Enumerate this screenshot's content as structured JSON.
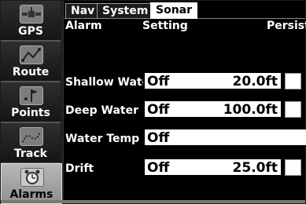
{
  "sidebar": {
    "items": [
      {
        "label": "GPS",
        "icon": "satellite-icon",
        "active": false
      },
      {
        "label": "Route",
        "icon": "route-icon",
        "active": false
      },
      {
        "label": "Points",
        "icon": "points-icon",
        "active": false
      },
      {
        "label": "Track",
        "icon": "track-icon",
        "active": false
      },
      {
        "label": "Alarms",
        "icon": "alarm-clock-icon",
        "active": true
      }
    ]
  },
  "tabs": [
    {
      "label": "Nav",
      "active": false
    },
    {
      "label": "System",
      "active": false
    },
    {
      "label": "Sonar",
      "active": true
    }
  ],
  "columns": {
    "alarm": "Alarm",
    "setting": "Setting",
    "persist": "Persist"
  },
  "rows": [
    {
      "label": "Shallow Water",
      "state": "Off",
      "value": "20.0ft"
    },
    {
      "label": "Deep Water",
      "state": "Off",
      "value": "100.0ft"
    },
    {
      "label": "Water Temp",
      "state": "Off",
      "value": ""
    },
    {
      "label": "Drift",
      "state": "Off",
      "value": "25.0ft"
    }
  ]
}
